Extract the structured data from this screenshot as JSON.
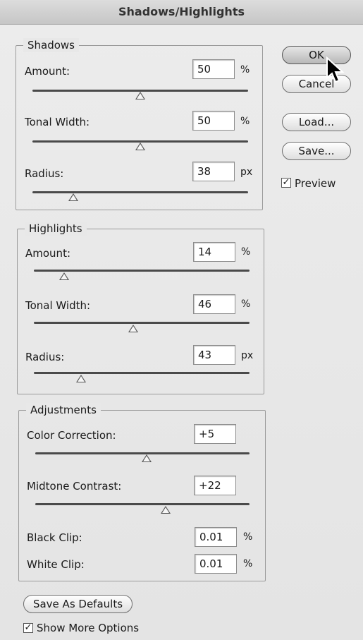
{
  "window": {
    "title": "Shadows/Highlights"
  },
  "shadows": {
    "title": "Shadows",
    "amount": {
      "label": "Amount:",
      "value": "50",
      "unit": "%",
      "level": 0.5
    },
    "tonal_width": {
      "label": "Tonal Width:",
      "value": "50",
      "unit": "%",
      "level": 0.5
    },
    "radius": {
      "label": "Radius:",
      "value": "38",
      "unit": "px",
      "level": 0.19
    }
  },
  "highlights": {
    "title": "Highlights",
    "amount": {
      "label": "Amount:",
      "value": "14",
      "unit": "%",
      "level": 0.14
    },
    "tonal_width": {
      "label": "Tonal Width:",
      "value": "46",
      "unit": "%",
      "level": 0.46
    },
    "radius": {
      "label": "Radius:",
      "value": "43",
      "unit": "px",
      "level": 0.22
    }
  },
  "adjustments": {
    "title": "Adjustments",
    "color_correction": {
      "label": "Color Correction:",
      "value": "+5",
      "level": 0.52
    },
    "midtone_contrast": {
      "label": "Midtone Contrast:",
      "value": "+22",
      "level": 0.61
    },
    "black_clip": {
      "label": "Black Clip:",
      "value": "0.01",
      "unit": "%"
    },
    "white_clip": {
      "label": "White Clip:",
      "value": "0.01",
      "unit": "%"
    }
  },
  "buttons": {
    "ok": "OK",
    "cancel": "Cancel",
    "load": "Load...",
    "save": "Save...",
    "save_as_defaults": "Save As Defaults"
  },
  "preview": {
    "label": "Preview",
    "checked": true
  },
  "show_more_options": {
    "label": "Show More Options",
    "checked": true
  }
}
